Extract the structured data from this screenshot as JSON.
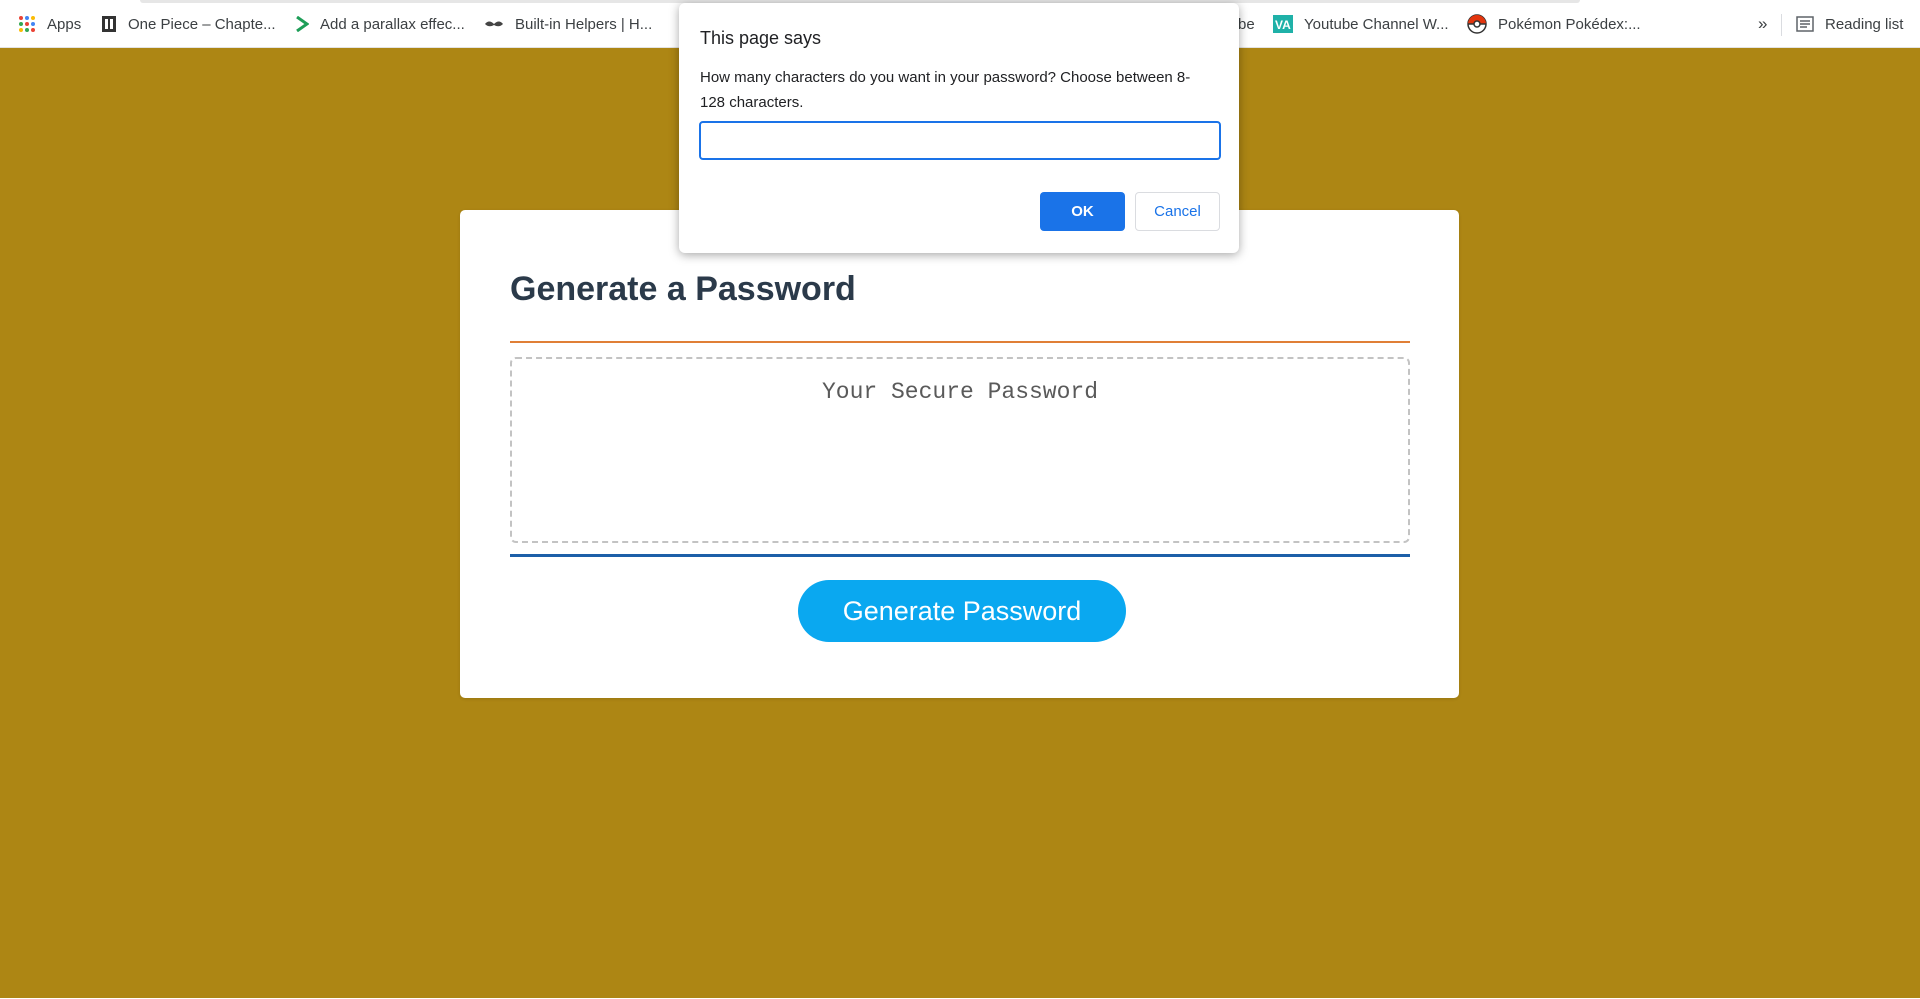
{
  "colors": {
    "page_background": "#ad8614",
    "accent_blue": "#1a73e8",
    "generate_button": "#0aa8f0",
    "rule_top": "#e07f36",
    "rule_bottom": "#1d5fa8"
  },
  "bookmarks": {
    "items": [
      {
        "label": "Apps",
        "icon": "apps-grid-icon"
      },
      {
        "label": "One Piece – Chapte...",
        "icon": "bookmark-favicon-icon"
      },
      {
        "label": "Add a parallax effec...",
        "icon": "chevron-favicon-icon"
      },
      {
        "label": "Built-in Helpers | H...",
        "icon": "mustache-favicon-icon"
      },
      {
        "label": "be",
        "icon": ""
      },
      {
        "label": "Youtube Channel W...",
        "icon": "va-favicon-icon"
      },
      {
        "label": "Pokémon Pokédex:...",
        "icon": "pokeball-icon"
      }
    ],
    "more": "»",
    "reading_list": "Reading list"
  },
  "card": {
    "title": "Generate a Password",
    "password_placeholder": "Your Secure Password",
    "generate_button": "Generate Password"
  },
  "dialog": {
    "title": "This page says",
    "message": "How many characters do you want in your password? Choose between 8-128 characters.",
    "input_value": "",
    "ok_label": "OK",
    "cancel_label": "Cancel"
  }
}
